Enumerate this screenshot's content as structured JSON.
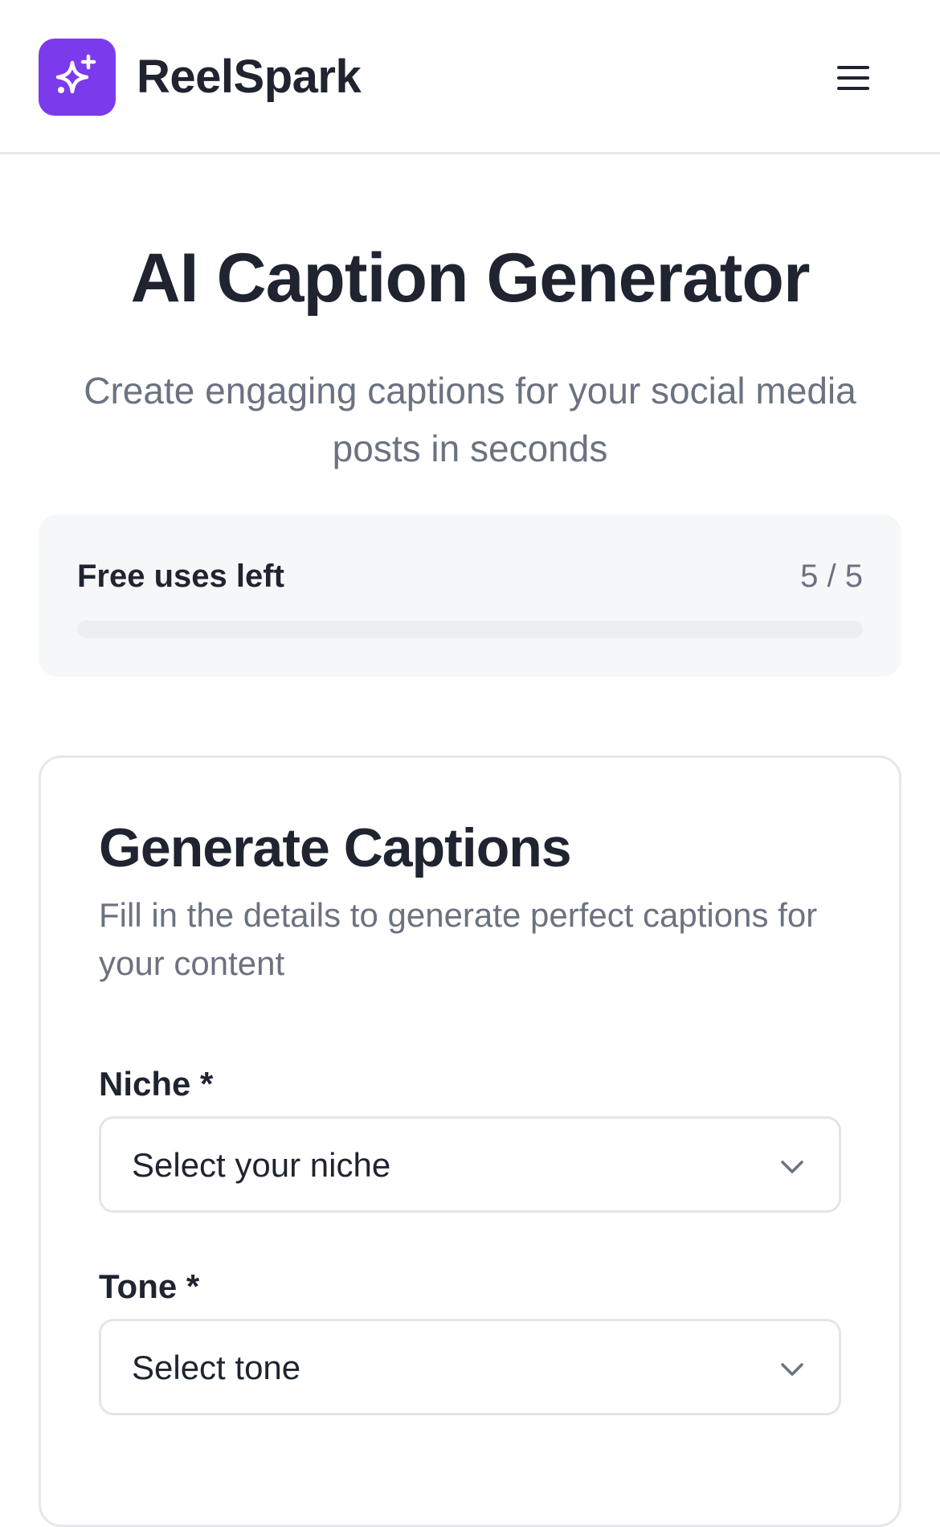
{
  "header": {
    "brand": "ReelSpark",
    "logo_icon": "sparkles-icon",
    "menu_icon": "hamburger-menu-icon",
    "accent_color": "#7c3aed"
  },
  "hero": {
    "title": "AI Caption Generator",
    "subtitle": "Create engaging captions for your social media posts in seconds"
  },
  "usage": {
    "label": "Free uses left",
    "count_text": "5 / 5",
    "progress_fraction": 0
  },
  "generator": {
    "title": "Generate Captions",
    "description": "Fill in the details to generate perfect captions for your content",
    "fields": [
      {
        "label": "Niche *",
        "value": "Select your niche"
      },
      {
        "label": "Tone *",
        "value": "Select tone"
      }
    ]
  }
}
